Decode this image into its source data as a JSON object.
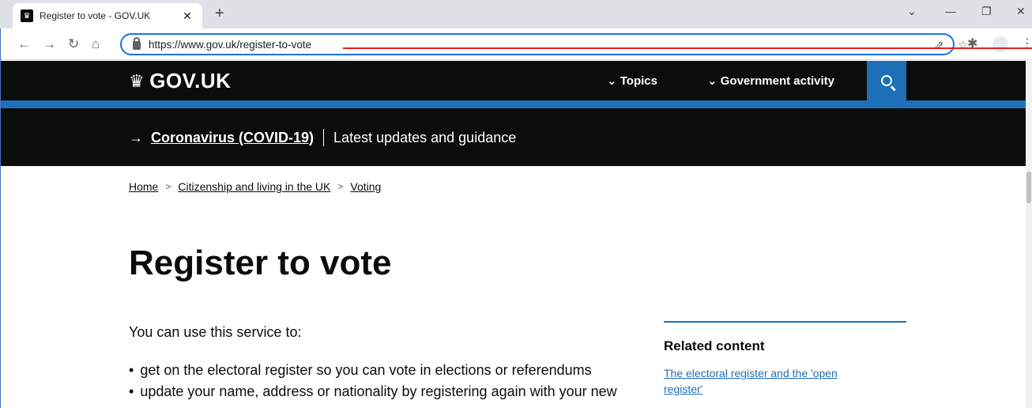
{
  "browser": {
    "tab_title": "Register to vote - GOV.UK",
    "new_tab": "+",
    "url": "https://www.gov.uk/register-to-vote"
  },
  "header": {
    "logo_text": "GOV.UK",
    "nav": [
      "Topics",
      "Government activity"
    ]
  },
  "banner": {
    "link": "Coronavirus (COVID-19)",
    "text": "Latest updates and guidance"
  },
  "breadcrumb": [
    "Home",
    "Citizenship and living in the UK",
    "Voting"
  ],
  "main": {
    "title": "Register to vote",
    "intro": "You can use this service to:",
    "bullets": [
      "get on the electoral register so you can vote in elections or referendums",
      "update your name, address or nationality by registering again with your new"
    ]
  },
  "related": {
    "heading": "Related content",
    "link_line1": "The electoral register and the 'open",
    "link_line2": "register'"
  },
  "colors": {
    "gov_black": "#0b0c0c",
    "gov_blue": "#1d70b8",
    "annotation_red": "#e8201e"
  }
}
